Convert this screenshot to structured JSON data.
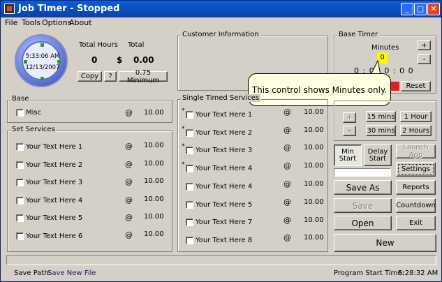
{
  "window": {
    "title": "Job Timer - Stopped",
    "controls": [
      "_",
      "□",
      "✕"
    ]
  },
  "menu": [
    "File",
    "Tools",
    "Options",
    "About"
  ],
  "clock": {
    "time": "5:33:06 AM",
    "date": "12/13/2007"
  },
  "totals": {
    "total_hours_label": "Total Hours",
    "total_label": "Total",
    "hours_value": "0",
    "currency": "$",
    "amount": "0.00",
    "copy_label": "Copy",
    "help_label": "?",
    "minimum_label": "0.75 Minimum"
  },
  "customer_info": {
    "label": "Customer Information"
  },
  "base_timer": {
    "label": "Base Timer",
    "minutes_label": "Minutes",
    "minutes_value": "0",
    "plus": "+",
    "minus": "-",
    "display": "0 : 0 : 0 : 0 0",
    "reset_label": "Reset"
  },
  "tooltip": {
    "text": "This control shows Minutes only."
  },
  "base": {
    "label": "Base",
    "items": [
      {
        "name": "Misc",
        "at": "@",
        "price": "10.00"
      }
    ]
  },
  "set_services": {
    "label": "Set Services",
    "items": [
      {
        "name": "Your Text Here 1",
        "at": "@",
        "price": "10.00"
      },
      {
        "name": "Your Text Here 2",
        "at": "@",
        "price": "10.00"
      },
      {
        "name": "Your Text Here 3",
        "at": "@",
        "price": "10.00"
      },
      {
        "name": "Your Text Here 4",
        "at": "@",
        "price": "10.00"
      },
      {
        "name": "Your Text Here 5",
        "at": "@",
        "price": "10.00"
      },
      {
        "name": "Your Text Here 6",
        "at": "@",
        "price": "10.00"
      }
    ]
  },
  "single_timed": {
    "label": "Single Timed Services",
    "star": "*",
    "items": [
      {
        "name": "Your Text Here 1",
        "at": "@",
        "price": "10.00"
      },
      {
        "name": "Your Text Here 2",
        "at": "@",
        "price": "10.00"
      },
      {
        "name": "Your Text Here 3",
        "at": "@",
        "price": "10.00"
      },
      {
        "name": "Your Text Here 4",
        "at": "@",
        "price": "10.00"
      },
      {
        "name": "Your Text Here 4",
        "at": "@",
        "price": "10.00"
      },
      {
        "name": "Your Text Here 5",
        "at": "@",
        "price": "10.00"
      },
      {
        "name": "Your Text Here 7",
        "at": "@",
        "price": "10.00"
      },
      {
        "name": "Your Text Here 8",
        "at": "@",
        "price": "10.00"
      }
    ]
  },
  "time_adjust": {
    "plus": "+",
    "minus": "-",
    "b15": "15 mins",
    "b30": "30 mins",
    "b1h": "1 Hour",
    "b2h": "2 Hours"
  },
  "actions": {
    "min_start": "Min\nStart",
    "delay_start": "Delay\nStart",
    "launch_app": "Launch App",
    "settings": "Settings",
    "save_as": "Save As",
    "reports": "Reports",
    "save": "Save",
    "countdown": "Countdown",
    "open": "Open",
    "exit": "Exit",
    "new": "New"
  },
  "footer": {
    "save_path_label": "Save Path:",
    "save_path_value": "Save New File",
    "start_time_label": "Program Start Time:",
    "start_time_value": "5:28:32 AM"
  }
}
